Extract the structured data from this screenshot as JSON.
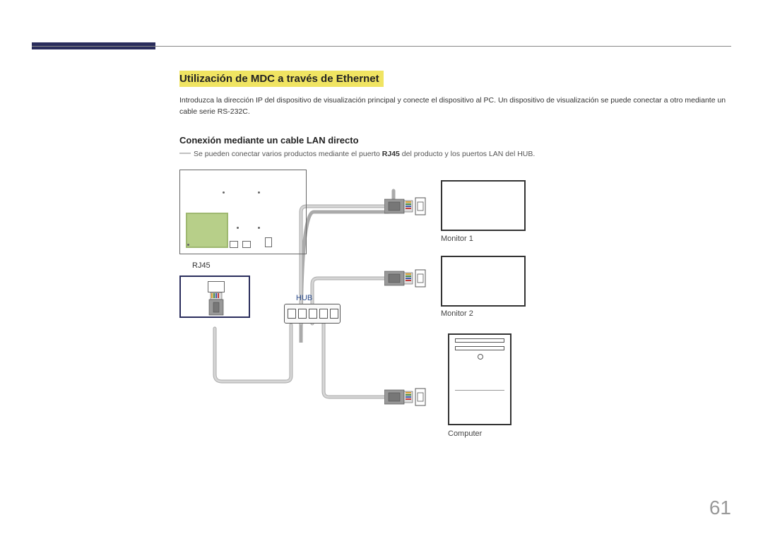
{
  "section_title": "Utilización de MDC a través de Ethernet",
  "intro_text": "Introduzca la dirección IP del dispositivo de visualización principal y conecte el dispositivo al PC. Un dispositivo de visualización se puede conectar a otro mediante un cable serie RS-232C.",
  "subheading": "Conexión mediante un cable LAN directo",
  "note_prefix": "―",
  "note_before": "Se pueden conectar varios productos mediante el puerto ",
  "note_bold": "RJ45",
  "note_after": " del producto y los puertos LAN del HUB.",
  "labels": {
    "rj45": "RJ45",
    "hub": "HUB",
    "monitor1": "Monitor 1",
    "monitor2": "Monitor 2",
    "computer": "Computer"
  },
  "page_number": "61"
}
